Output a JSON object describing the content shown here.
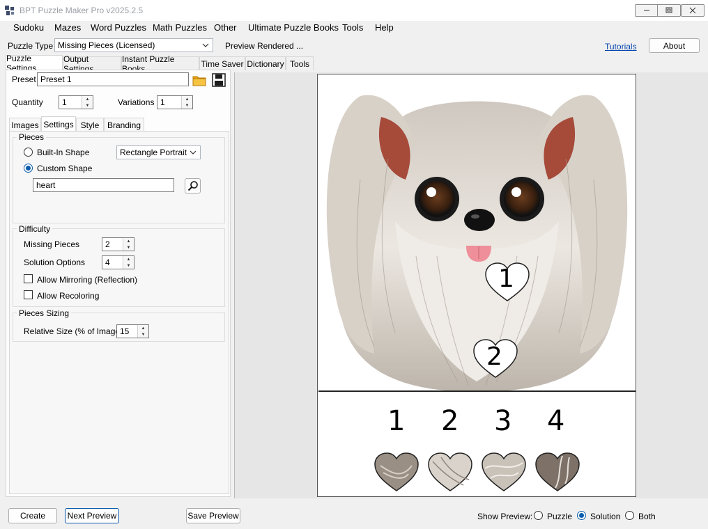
{
  "window": {
    "title": "BPT Puzzle Maker Pro v2025.2.5"
  },
  "menu": [
    "Sudoku",
    "Mazes",
    "Word Puzzles",
    "Math Puzzles",
    "Other",
    "Ultimate Puzzle Books",
    "Tools",
    "Help"
  ],
  "toolbar": {
    "puzzle_type_label": "Puzzle Type",
    "puzzle_type_value": "Missing Pieces (Licensed)",
    "status": "Preview Rendered ...",
    "tutorials": "Tutorials",
    "about": "About"
  },
  "main_tabs": [
    "Puzzle Settings",
    "Output Settings",
    "Instant Puzzle Books",
    "Time Saver",
    "Dictionary",
    "Tools"
  ],
  "preset": {
    "label": "Preset",
    "value": "Preset 1"
  },
  "quantity": {
    "label": "Quantity",
    "value": "1"
  },
  "variations": {
    "label": "Variations",
    "value": "1"
  },
  "sub_tabs": [
    "Images",
    "Settings",
    "Style",
    "Branding"
  ],
  "pieces": {
    "title": "Pieces",
    "builtin_label": "Built-In Shape",
    "builtin_value": "Rectangle Portrait",
    "custom_label": "Custom Shape",
    "custom_value": "heart"
  },
  "difficulty": {
    "title": "Difficulty",
    "missing_label": "Missing Pieces",
    "missing_value": "2",
    "solution_label": "Solution Options",
    "solution_value": "4",
    "mirroring_label": "Allow Mirroring (Reflection)",
    "recoloring_label": "Allow Recoloring"
  },
  "sizing": {
    "title": "Pieces Sizing",
    "relative_label": "Relative Size (% of Image)",
    "relative_value": "15"
  },
  "preview": {
    "markers": [
      "1",
      "2"
    ],
    "options": [
      "1",
      "2",
      "3",
      "4"
    ]
  },
  "bottom": {
    "create": "Create",
    "next_preview": "Next Preview",
    "save_preview": "Save Preview",
    "show_preview_label": "Show Preview:",
    "opt_puzzle": "Puzzle",
    "opt_solution": "Solution",
    "opt_both": "Both"
  },
  "colors": {
    "accent": "#0b5cad",
    "link": "#0645ad"
  }
}
